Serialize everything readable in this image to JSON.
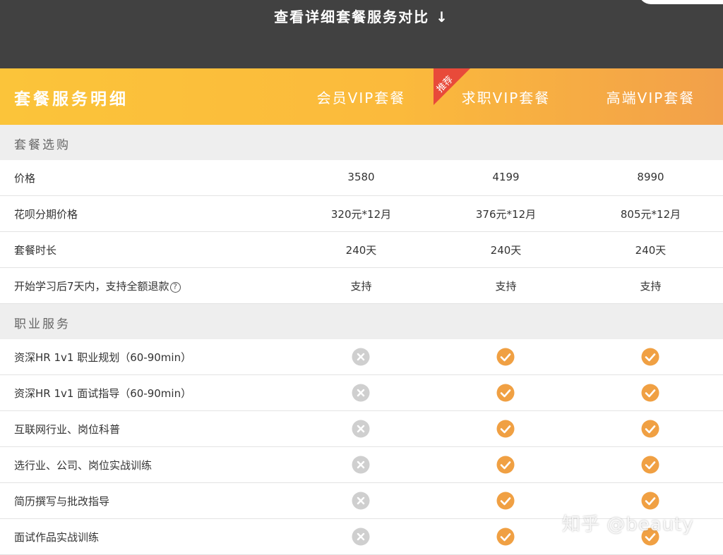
{
  "top_banner": {
    "title": "查看详细套餐服务对比 ↓"
  },
  "header": {
    "title": "套餐服务明细",
    "plans": [
      "会员VIP套餐",
      "求职VIP套餐",
      "高端VIP套餐"
    ],
    "recommend_badge": "推荐"
  },
  "sections": {
    "purchase": "套餐选购",
    "career": "职业服务"
  },
  "purchase_rows": [
    {
      "label": "价格",
      "values": [
        "3580",
        "4199",
        "8990"
      ]
    },
    {
      "label": "花呗分期价格",
      "values": [
        "320元*12月",
        "376元*12月",
        "805元*12月"
      ]
    },
    {
      "label": "套餐时长",
      "values": [
        "240天",
        "240天",
        "240天"
      ]
    },
    {
      "label": "开始学习后7天内，支持全额退款",
      "values": [
        "支持",
        "支持",
        "支持"
      ],
      "help_glyph": "?"
    }
  ],
  "career_rows": [
    {
      "label": "资深HR 1v1 职业规划（60-90min）",
      "included": [
        false,
        true,
        true
      ]
    },
    {
      "label": "资深HR 1v1 面试指导（60-90min）",
      "included": [
        false,
        true,
        true
      ]
    },
    {
      "label": "互联网行业、岗位科普",
      "included": [
        false,
        true,
        true
      ]
    },
    {
      "label": "选行业、公司、岗位实战训练",
      "included": [
        false,
        true,
        true
      ]
    },
    {
      "label": "简历撰写与批改指导",
      "included": [
        false,
        true,
        true
      ]
    },
    {
      "label": "面试作品实战训练",
      "included": [
        false,
        true,
        true
      ]
    }
  ],
  "colors": {
    "check": "#f0a043",
    "cross": "#cfcfcf",
    "ribbon": "#e84a3a"
  },
  "watermark": "知乎 @beauty"
}
